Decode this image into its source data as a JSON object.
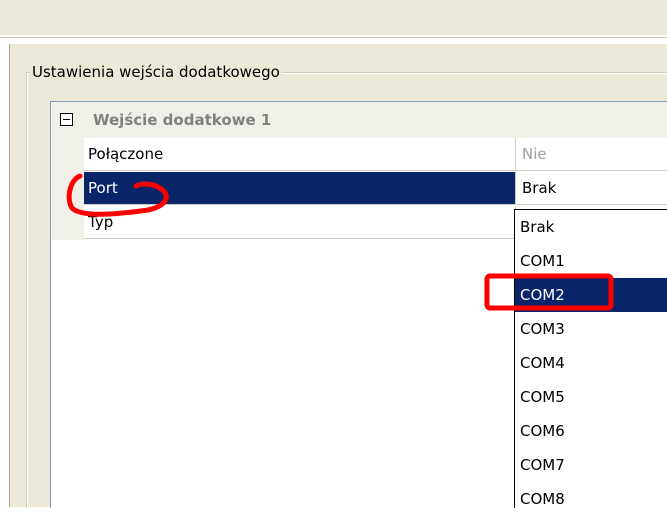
{
  "group": {
    "title": "Ustawienia wejścia dodatkowego"
  },
  "grid": {
    "category": "Wejście dodatkowe 1",
    "rows": [
      {
        "name": "Połączone",
        "value": "Nie"
      },
      {
        "name": "Port",
        "value": "Brak"
      },
      {
        "name": "Typ",
        "value": ""
      }
    ]
  },
  "dropdown": {
    "items": [
      "Brak",
      "COM1",
      "COM2",
      "COM3",
      "COM4",
      "COM5",
      "COM6",
      "COM7",
      "COM8"
    ],
    "selected": "COM2"
  },
  "colors": {
    "selection": "#0a246a",
    "annotation": "#ff0000",
    "panel": "#ece9d8"
  }
}
